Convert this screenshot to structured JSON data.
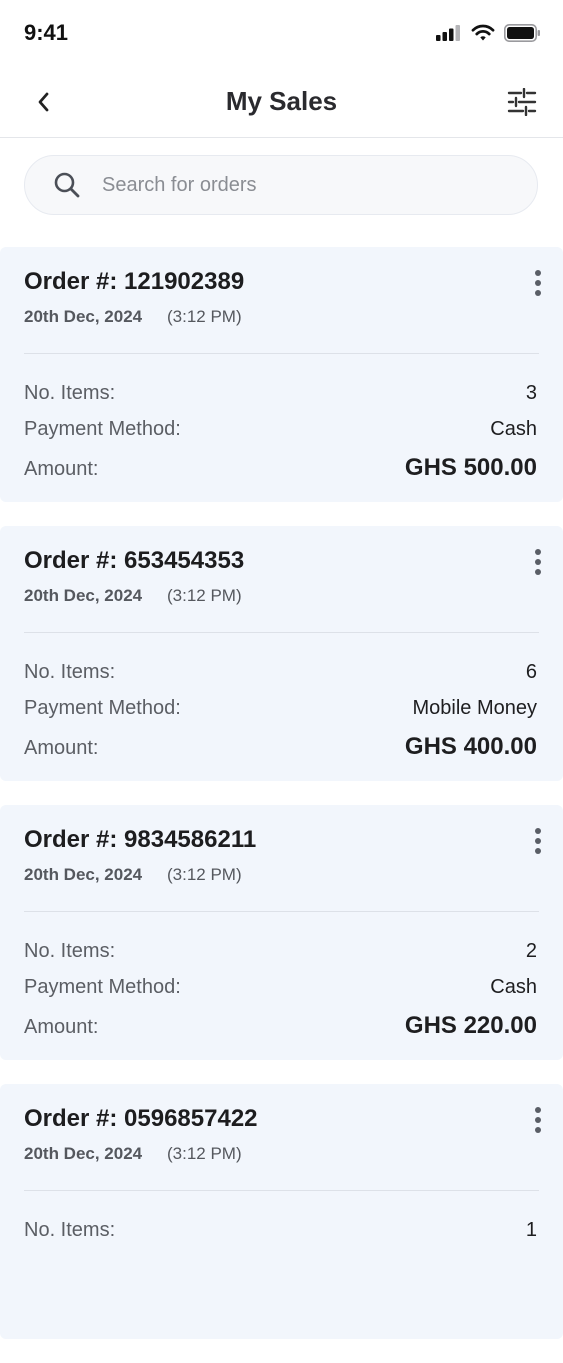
{
  "status_bar": {
    "time": "9:41"
  },
  "header": {
    "title": "My Sales"
  },
  "search": {
    "placeholder": "Search for orders"
  },
  "labels": {
    "items": "No. Items:",
    "payment": "Payment Method:",
    "amount": "Amount:"
  },
  "orders": [
    {
      "number": "Order #: 121902389",
      "date": "20th Dec, 2024",
      "time": "(3:12 PM)",
      "items": "3",
      "payment_method": "Cash",
      "amount": "GHS 500.00"
    },
    {
      "number": "Order #: 653454353",
      "date": "20th Dec, 2024",
      "time": "(3:12 PM)",
      "items": "6",
      "payment_method": "Mobile Money",
      "amount": "GHS 400.00"
    },
    {
      "number": "Order #: 9834586211",
      "date": "20th Dec, 2024",
      "time": "(3:12 PM)",
      "items": "2",
      "payment_method": "Cash",
      "amount": "GHS 220.00"
    },
    {
      "number": "Order #: 0596857422",
      "date": "20th Dec, 2024",
      "time": "(3:12 PM)",
      "items": "1"
    }
  ],
  "icons": {
    "back": "chevron-left-icon",
    "filter": "sliders-icon",
    "search": "search-icon",
    "more": "more-vertical-icon",
    "signal": "cellular-signal-icon",
    "wifi": "wifi-icon",
    "battery": "battery-icon"
  }
}
